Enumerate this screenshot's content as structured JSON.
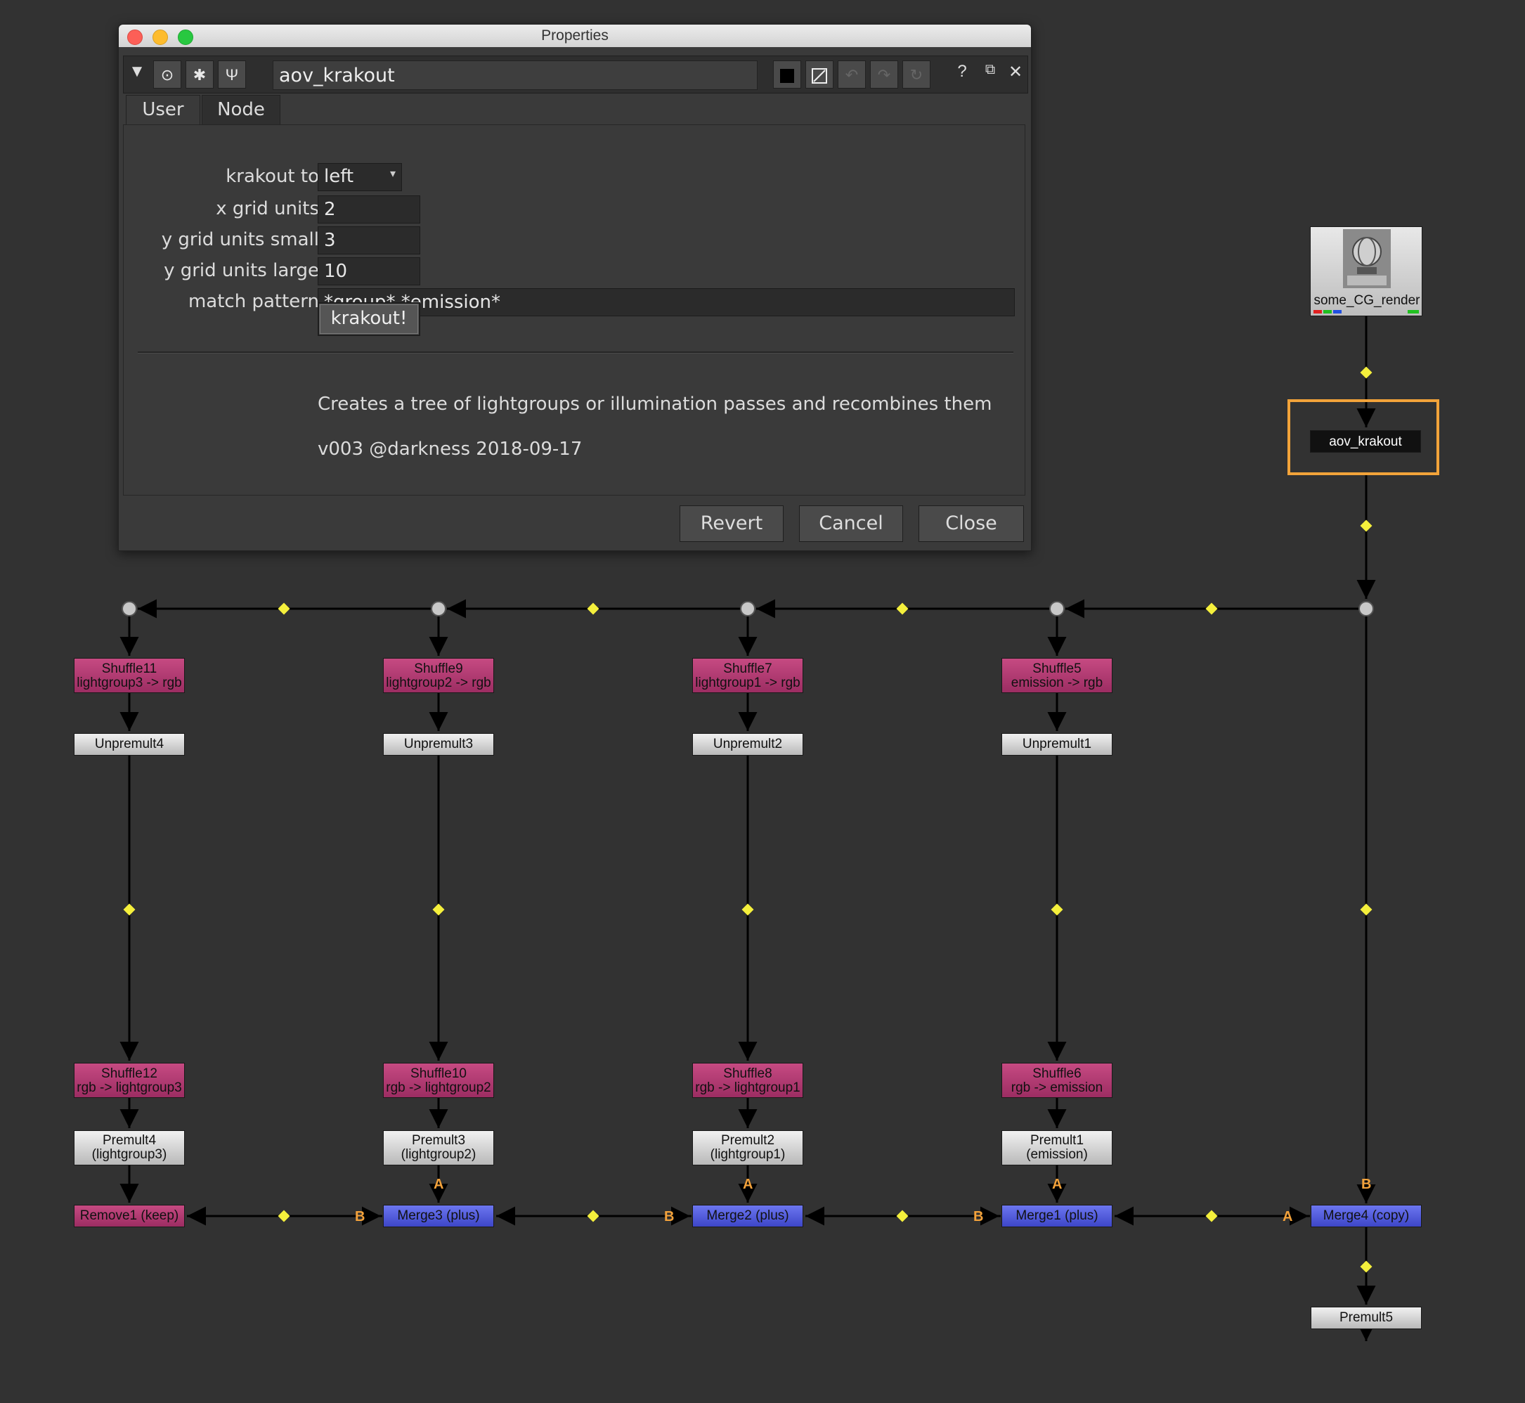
{
  "window": {
    "title": "Properties",
    "node_name": "aov_krakout",
    "tabs": [
      "User",
      "Node"
    ],
    "fields": {
      "krakout_to": {
        "label": "krakout to",
        "value": "left"
      },
      "x_grid_units": {
        "label": "x grid units",
        "value": "2"
      },
      "y_grid_units_small": {
        "label": "y grid units small",
        "value": "3"
      },
      "y_grid_units_large": {
        "label": "y grid units large",
        "value": "10"
      },
      "match_pattern": {
        "label": "match pattern",
        "value": "*group*,*emission*"
      }
    },
    "krakout_button": "krakout!",
    "description": "Creates a tree of lightgroups or illumination passes and recombines them",
    "version": "v003 @darkness 2018-09-17",
    "buttons": {
      "revert": "Revert",
      "cancel": "Cancel",
      "close": "Close"
    },
    "toolbar_icons": [
      "collapse-icon",
      "viewer-icon",
      "bug-icon",
      "wrench-icon",
      "color-swatch-icon",
      "color-picker-icon",
      "undo-icon",
      "redo-icon",
      "revert-icon",
      "help-icon",
      "float-icon",
      "close-icon"
    ],
    "toolbar_glyphs": {
      "help": "?",
      "float": "⧉",
      "close": "✕"
    }
  },
  "graph": {
    "read_node": "some_CG_render",
    "krakout_node": "aov_krakout",
    "columns": [
      {
        "shuffle_top": [
          "Shuffle11",
          "lightgroup3 -> rgb"
        ],
        "unpremult": "Unpremult4",
        "shuffle_bottom": [
          "Shuffle12",
          "rgb -> lightgroup3"
        ],
        "premult": [
          "Premult4",
          "(lightgroup3)"
        ],
        "merge": "Remove1 (keep)"
      },
      {
        "shuffle_top": [
          "Shuffle9",
          "lightgroup2 -> rgb"
        ],
        "unpremult": "Unpremult3",
        "shuffle_bottom": [
          "Shuffle10",
          "rgb -> lightgroup2"
        ],
        "premult": [
          "Premult3",
          "(lightgroup2)"
        ],
        "merge": "Merge3 (plus)"
      },
      {
        "shuffle_top": [
          "Shuffle7",
          "lightgroup1 -> rgb"
        ],
        "unpremult": "Unpremult2",
        "shuffle_bottom": [
          "Shuffle8",
          "rgb -> lightgroup1"
        ],
        "premult": [
          "Premult2",
          "(lightgroup1)"
        ],
        "merge": "Merge2 (plus)"
      },
      {
        "shuffle_top": [
          "Shuffle5",
          "emission -> rgb"
        ],
        "unpremult": "Unpremult1",
        "shuffle_bottom": [
          "Shuffle6",
          "rgb -> emission"
        ],
        "premult": [
          "Premult1",
          "(emission)"
        ],
        "merge": "Merge1 (plus)"
      }
    ],
    "merge_final": "Merge4 (copy)",
    "premult_final": "Premult5",
    "ports": {
      "a": "A",
      "b": "B"
    },
    "colors": {
      "shuffle": "#b03a70",
      "merge": "#4f58dc",
      "premult": "#d4d4d4",
      "dot": "#f5f03c",
      "selection": "#f2a33a"
    }
  }
}
